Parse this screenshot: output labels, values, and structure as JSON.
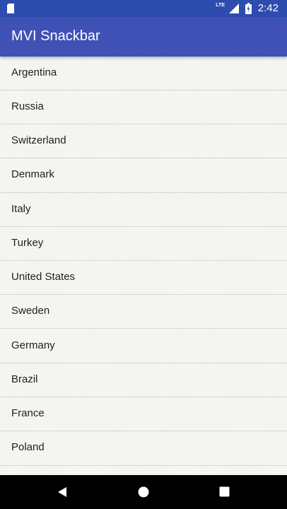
{
  "status_bar": {
    "network_label": "LTE",
    "time": "2:42",
    "icons": [
      "sd-card-icon",
      "signal-icon",
      "battery-icon"
    ]
  },
  "app_bar": {
    "title": "MVI Snackbar",
    "color": "#3f51b5"
  },
  "list": {
    "items": [
      {
        "label": "Argentina"
      },
      {
        "label": "Russia"
      },
      {
        "label": "Switzerland"
      },
      {
        "label": "Denmark"
      },
      {
        "label": "Italy"
      },
      {
        "label": "Turkey"
      },
      {
        "label": "United States"
      },
      {
        "label": "Sweden"
      },
      {
        "label": "Germany"
      },
      {
        "label": "Brazil"
      },
      {
        "label": "France"
      },
      {
        "label": "Poland"
      }
    ]
  },
  "nav_bar": {
    "icons": [
      "back-icon",
      "home-icon",
      "recents-icon"
    ]
  }
}
